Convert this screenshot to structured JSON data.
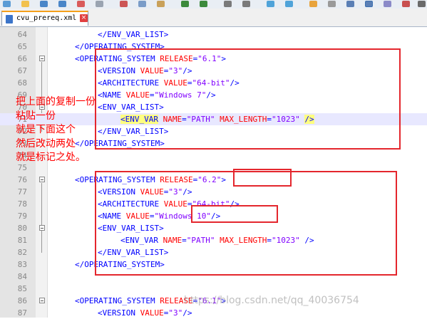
{
  "tab": {
    "title": "cvu_prereq.xml",
    "close_icon": "close-icon"
  },
  "code_lines": [
    {
      "num": "64",
      "indent": 2,
      "fold": false,
      "tokens": [
        [
          "tag",
          "</ENV_VAR_LIST>"
        ]
      ]
    },
    {
      "num": "65",
      "indent": 1,
      "fold": false,
      "tokens": [
        [
          "tag",
          "</OPERATING_SYSTEM>"
        ]
      ]
    },
    {
      "num": "66",
      "indent": 1,
      "fold": true,
      "tokens": [
        [
          "tag",
          "<OPERATING_SYSTEM "
        ],
        [
          "attr",
          "RELEASE"
        ],
        [
          "tag",
          "="
        ],
        [
          "val",
          "\"6.1\""
        ],
        [
          "tag",
          ">"
        ]
      ]
    },
    {
      "num": "67",
      "indent": 2,
      "fold": false,
      "tokens": [
        [
          "tag",
          "<VERSION "
        ],
        [
          "attr",
          "VALUE"
        ],
        [
          "tag",
          "="
        ],
        [
          "val",
          "\"3\""
        ],
        [
          "tag",
          "/>"
        ]
      ]
    },
    {
      "num": "68",
      "indent": 2,
      "fold": false,
      "tokens": [
        [
          "tag",
          "<ARCHITECTURE "
        ],
        [
          "attr",
          "VALUE"
        ],
        [
          "tag",
          "="
        ],
        [
          "val",
          "\"64-bit\""
        ],
        [
          "tag",
          "/>"
        ]
      ]
    },
    {
      "num": "69",
      "indent": 2,
      "fold": false,
      "tokens": [
        [
          "tag",
          "<NAME "
        ],
        [
          "attr",
          "VALUE"
        ],
        [
          "tag",
          "="
        ],
        [
          "val",
          "\"Windows 7\""
        ],
        [
          "tag",
          "/>"
        ]
      ]
    },
    {
      "num": "70",
      "indent": 2,
      "fold": true,
      "tokens": [
        [
          "tag",
          "<ENV_VAR_LIST>"
        ]
      ]
    },
    {
      "num": "71",
      "indent": 3,
      "fold": false,
      "highlight": true,
      "tokens": [
        [
          "hltag",
          "<ENV_VAR"
        ],
        [
          "tag",
          " "
        ],
        [
          "attr",
          "NAME"
        ],
        [
          "tag",
          "="
        ],
        [
          "val",
          "\"PATH\""
        ],
        [
          "tag",
          " "
        ],
        [
          "attr",
          "MAX_LENGTH"
        ],
        [
          "tag",
          "="
        ],
        [
          "val",
          "\"1023\""
        ],
        [
          "tag",
          " "
        ],
        [
          "hltag",
          "/>"
        ]
      ]
    },
    {
      "num": "72",
      "indent": 2,
      "fold": false,
      "tokens": [
        [
          "tag",
          "</ENV_VAR_LIST>"
        ]
      ]
    },
    {
      "num": "73",
      "indent": 1,
      "fold": false,
      "tokens": [
        [
          "tag",
          "</OPERATING_SYSTEM>"
        ]
      ]
    },
    {
      "num": "74",
      "indent": 0,
      "fold": false,
      "tokens": []
    },
    {
      "num": "75",
      "indent": 0,
      "fold": false,
      "tokens": []
    },
    {
      "num": "76",
      "indent": 1,
      "fold": true,
      "tokens": [
        [
          "tag",
          "<OPERATING_SYSTEM "
        ],
        [
          "attr",
          "RELEASE"
        ],
        [
          "tag",
          "="
        ],
        [
          "val",
          "\"6.2\""
        ],
        [
          "tag",
          ">"
        ]
      ]
    },
    {
      "num": "77",
      "indent": 2,
      "fold": false,
      "tokens": [
        [
          "tag",
          "<VERSION "
        ],
        [
          "attr",
          "VALUE"
        ],
        [
          "tag",
          "="
        ],
        [
          "val",
          "\"3\""
        ],
        [
          "tag",
          "/>"
        ]
      ]
    },
    {
      "num": "78",
      "indent": 2,
      "fold": false,
      "tokens": [
        [
          "tag",
          "<ARCHITECTURE "
        ],
        [
          "attr",
          "VALUE"
        ],
        [
          "tag",
          "="
        ],
        [
          "val",
          "\"64-bit\""
        ],
        [
          "tag",
          "/>"
        ]
      ]
    },
    {
      "num": "79",
      "indent": 2,
      "fold": false,
      "tokens": [
        [
          "tag",
          "<NAME "
        ],
        [
          "attr",
          "VALUE"
        ],
        [
          "tag",
          "="
        ],
        [
          "val",
          "\"Windows 10\""
        ],
        [
          "tag",
          "/>"
        ]
      ]
    },
    {
      "num": "80",
      "indent": 2,
      "fold": true,
      "tokens": [
        [
          "tag",
          "<ENV_VAR_LIST>"
        ]
      ]
    },
    {
      "num": "81",
      "indent": 3,
      "fold": false,
      "tokens": [
        [
          "tag",
          "<ENV_VAR "
        ],
        [
          "attr",
          "NAME"
        ],
        [
          "tag",
          "="
        ],
        [
          "val",
          "\"PATH\""
        ],
        [
          "tag",
          " "
        ],
        [
          "attr",
          "MAX_LENGTH"
        ],
        [
          "tag",
          "="
        ],
        [
          "val",
          "\"1023\""
        ],
        [
          "tag",
          " />"
        ]
      ]
    },
    {
      "num": "82",
      "indent": 2,
      "fold": false,
      "tokens": [
        [
          "tag",
          "</ENV_VAR_LIST>"
        ]
      ]
    },
    {
      "num": "83",
      "indent": 1,
      "fold": false,
      "tokens": [
        [
          "tag",
          "</OPERATING_SYSTEM>"
        ]
      ]
    },
    {
      "num": "84",
      "indent": 0,
      "fold": false,
      "tokens": []
    },
    {
      "num": "85",
      "indent": 0,
      "fold": false,
      "tokens": []
    },
    {
      "num": "86",
      "indent": 1,
      "fold": true,
      "tokens": [
        [
          "tag",
          "<OPERATING_SYSTEM "
        ],
        [
          "attr",
          "RELEASE"
        ],
        [
          "tag",
          "="
        ],
        [
          "val",
          "\"6.1\""
        ],
        [
          "tag",
          ">"
        ]
      ]
    },
    {
      "num": "87",
      "indent": 2,
      "fold": false,
      "tokens": [
        [
          "tag",
          "<VERSION "
        ],
        [
          "attr",
          "VALUE"
        ],
        [
          "tag",
          "="
        ],
        [
          "val",
          "\"3\""
        ],
        [
          "tag",
          "/>"
        ]
      ]
    }
  ],
  "annotation_note": "把上面的复制一份\n粘贴一份\n就是下面这个\n然后改动两处\n就是标记之处。",
  "watermark": "https://blog.csdn.net/qq_40036754",
  "colors": {
    "tag": "#0000ff",
    "attribute": "#ff0000",
    "value": "#8000ff",
    "markup_box": "#e4262d",
    "note": "#ff0000"
  }
}
